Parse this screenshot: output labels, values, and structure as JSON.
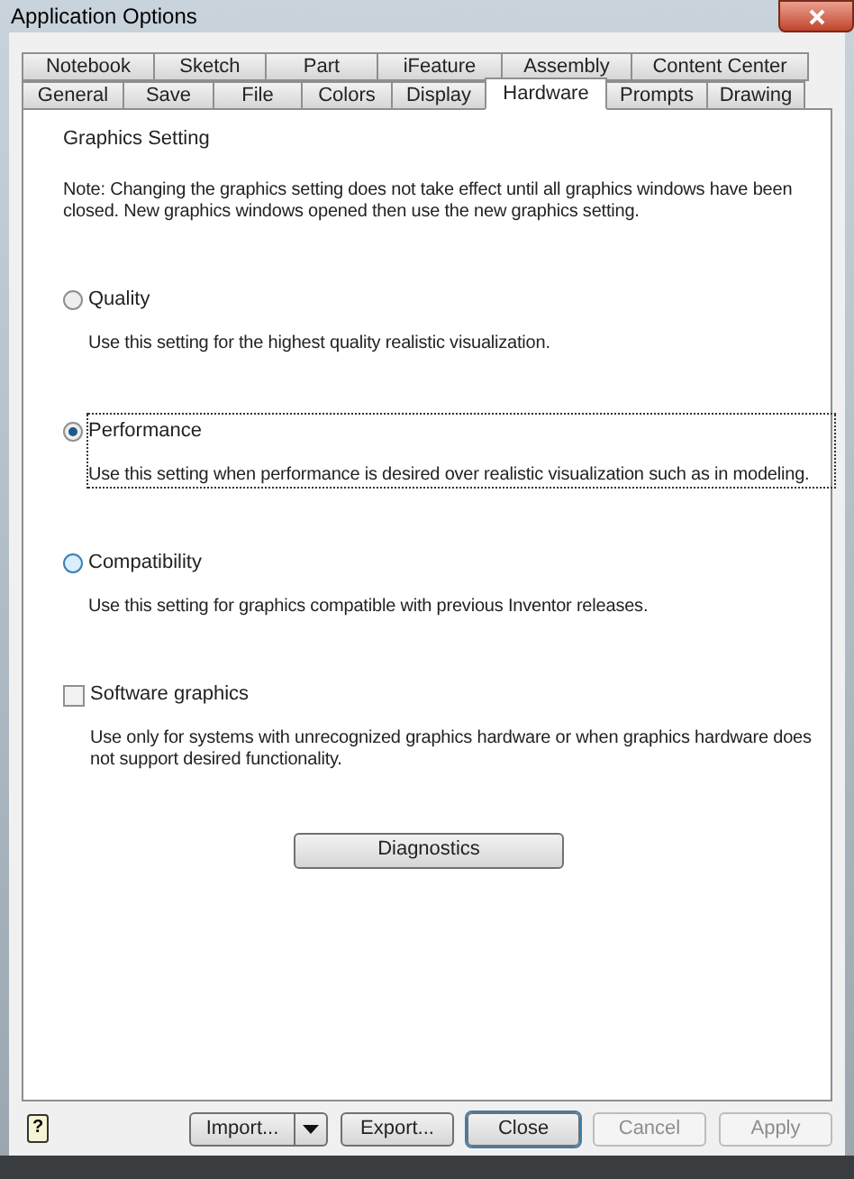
{
  "window": {
    "title": "Application Options"
  },
  "tabs_row_1": [
    {
      "label": "Notebook",
      "selected": false
    },
    {
      "label": "Sketch",
      "selected": false
    },
    {
      "label": "Part",
      "selected": false
    },
    {
      "label": "iFeature",
      "selected": false
    },
    {
      "label": "Assembly",
      "selected": false
    },
    {
      "label": "Content Center",
      "selected": false
    }
  ],
  "tabs_row_2": [
    {
      "label": "General",
      "selected": false
    },
    {
      "label": "Save",
      "selected": false
    },
    {
      "label": "File",
      "selected": false
    },
    {
      "label": "Colors",
      "selected": false
    },
    {
      "label": "Display",
      "selected": false
    },
    {
      "label": "Hardware",
      "selected": true
    },
    {
      "label": "Prompts",
      "selected": false
    },
    {
      "label": "Drawing",
      "selected": false
    }
  ],
  "panel": {
    "heading": "Graphics Setting",
    "note": "Note: Changing the graphics setting does not take effect until all graphics windows have been closed.  New graphics windows opened then use the new graphics setting.",
    "options": [
      {
        "kind": "radio",
        "label": "Quality",
        "selected": false,
        "focused": false,
        "hovered": false,
        "description": "Use this setting for the highest quality realistic visualization."
      },
      {
        "kind": "radio",
        "label": "Performance",
        "selected": true,
        "focused": true,
        "hovered": false,
        "description": "Use this setting when performance is desired over realistic visualization such as in modeling."
      },
      {
        "kind": "radio",
        "label": "Compatibility",
        "selected": false,
        "focused": false,
        "hovered": true,
        "description": "Use this setting for graphics compatible with previous Inventor releases."
      },
      {
        "kind": "checkbox",
        "label": "Software graphics",
        "checked": false,
        "focused": false,
        "hovered": false,
        "description": "Use only for systems with unrecognized graphics hardware or when graphics hardware does not support desired functionality."
      }
    ],
    "diagnostics_button": "Diagnostics"
  },
  "footer": {
    "help": "?",
    "buttons": [
      {
        "kind": "split",
        "label": "Import...",
        "disabled": false,
        "default": false
      },
      {
        "kind": "plain",
        "label": "Export...",
        "disabled": false,
        "default": false
      },
      {
        "kind": "plain",
        "label": "Close",
        "disabled": false,
        "default": true
      },
      {
        "kind": "plain",
        "label": "Cancel",
        "disabled": true,
        "default": false
      },
      {
        "kind": "plain",
        "label": "Apply",
        "disabled": true,
        "default": false
      }
    ]
  }
}
